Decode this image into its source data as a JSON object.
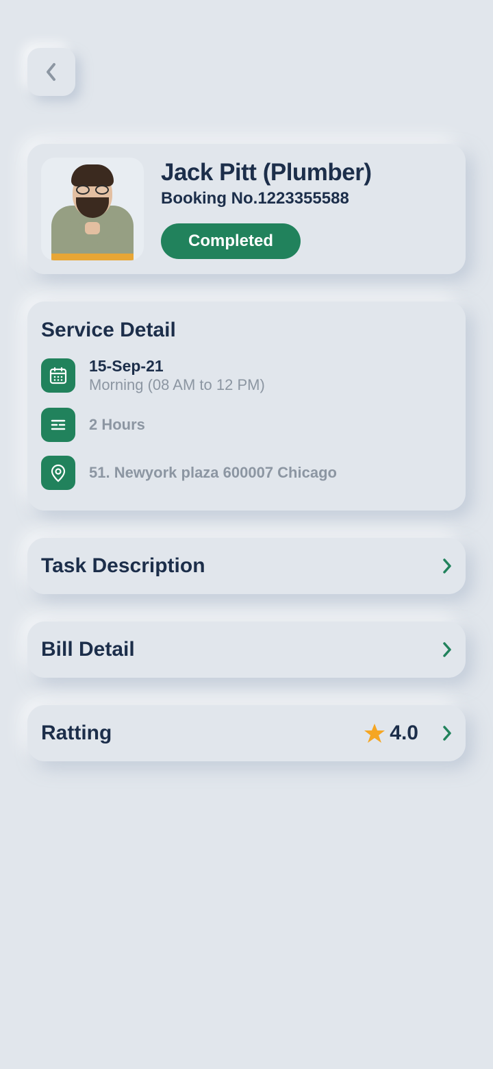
{
  "provider": {
    "name": "Jack Pitt (Plumber)",
    "booking": "Booking No.1223355588",
    "status": "Completed"
  },
  "serviceDetail": {
    "title": "Service Detail",
    "date": "15-Sep-21",
    "timeSlot": "Morning (08 AM to 12 PM)",
    "duration": "2 Hours",
    "address": "51. Newyork plaza 600007 Chicago"
  },
  "sections": {
    "taskDescription": "Task Description",
    "billDetail": "Bill Detail",
    "rating": {
      "label": "Ratting",
      "value": "4.0"
    }
  },
  "colors": {
    "accent": "#21825C",
    "star": "#F5A623"
  }
}
